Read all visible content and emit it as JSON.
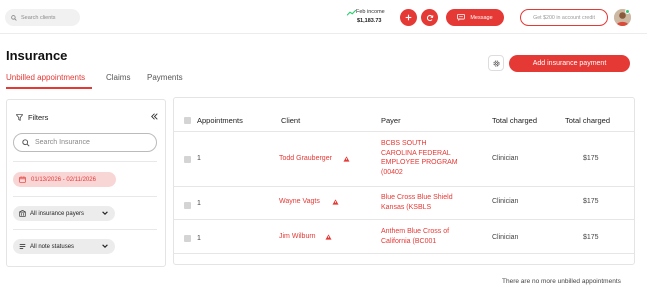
{
  "topbar": {
    "search_placeholder": "Search clients",
    "income_label": "Feb income",
    "income_amount": "$1,183.73",
    "message_label": "Message",
    "credit_label": "Get $200 in account credit"
  },
  "page": {
    "title": "Insurance",
    "tabs": [
      {
        "label": "Unbilled appointments",
        "active": true
      },
      {
        "label": "Claims",
        "active": false
      },
      {
        "label": "Payments",
        "active": false
      }
    ],
    "add_payment_label": "Add insurance payment"
  },
  "filters": {
    "title": "Filters",
    "search_placeholder": "Search Insurance",
    "date_range": "01/13/2026 - 02/11/2026",
    "payer_filter": "All insurance payers",
    "status_filter": "All note statuses"
  },
  "table": {
    "headers": {
      "appointments": "Appointments",
      "client": "Client",
      "payer": "Payer",
      "total_charged_1": "Total charged",
      "total_charged_2": "Total charged"
    },
    "rows": [
      {
        "appointments": "1",
        "client": "Todd Grauberger",
        "payer": "BCBS SOUTH CAROLINA FEDERAL EMPLOYEE PROGRAM (00402",
        "role": "Clinician",
        "charged": "$175"
      },
      {
        "appointments": "1",
        "client": "Wayne Vagts",
        "payer": "Blue Cross Blue Shield Kansas (KSBLS",
        "role": "Clinician",
        "charged": "$175"
      },
      {
        "appointments": "1",
        "client": "Jim Wilburn",
        "payer": "Anthem Blue Cross of California (BC001",
        "role": "Clinician",
        "charged": "$175"
      }
    ]
  },
  "footer_note": "There are no more unbilled appointments",
  "colors": {
    "accent": "#e53935",
    "income_trend": "#2ecc71",
    "date_pill_bg": "#f9d6d6"
  },
  "icons": [
    "search-icon",
    "trend-up-icon",
    "plus-icon",
    "refresh-icon",
    "message-icon",
    "gear-icon",
    "filter-icon",
    "collapse-icon",
    "calendar-icon",
    "building-icon",
    "list-icon",
    "chevron-down-icon",
    "warning-icon"
  ]
}
